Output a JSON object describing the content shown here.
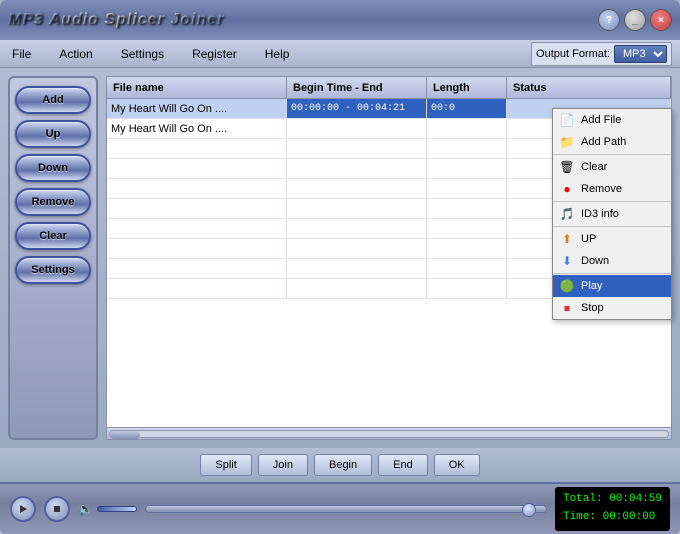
{
  "app": {
    "title": "MP3 Audio Splicer Joiner"
  },
  "title_controls": {
    "info": "?",
    "minimize": "_",
    "close": "×"
  },
  "menu": {
    "items": [
      {
        "id": "file",
        "label": "File"
      },
      {
        "id": "action",
        "label": "Action"
      },
      {
        "id": "settings",
        "label": "Settings"
      },
      {
        "id": "register",
        "label": "Register"
      },
      {
        "id": "help",
        "label": "Help"
      }
    ],
    "output_label": "Output Format:",
    "output_value": "MP3"
  },
  "sidebar": {
    "buttons": [
      {
        "id": "add",
        "label": "Add"
      },
      {
        "id": "up",
        "label": "Up"
      },
      {
        "id": "down",
        "label": "Down"
      },
      {
        "id": "remove",
        "label": "Remove"
      },
      {
        "id": "clear",
        "label": "Clear"
      },
      {
        "id": "settings",
        "label": "Settings"
      }
    ]
  },
  "table": {
    "headers": [
      {
        "id": "filename",
        "label": "File name"
      },
      {
        "id": "begin-end",
        "label": "Begin Time - End"
      },
      {
        "id": "length",
        "label": "Length"
      },
      {
        "id": "status",
        "label": "Status"
      }
    ],
    "rows": [
      {
        "filename": "My Heart Will Go On ....",
        "begin_end": "00:00:00 - 00:04:21",
        "length": "00:0",
        "status": "",
        "selected": true
      },
      {
        "filename": "My Heart Will Go On ....",
        "begin_end": "",
        "length": "",
        "status": "",
        "selected": false
      }
    ]
  },
  "context_menu": {
    "items": [
      {
        "id": "add-file",
        "label": "Add File",
        "icon": "📄"
      },
      {
        "id": "add-path",
        "label": "Add Path",
        "icon": "📁"
      },
      {
        "id": "clear",
        "label": "Clear",
        "icon": "🗑"
      },
      {
        "id": "remove",
        "label": "Remove",
        "icon": "❌"
      },
      {
        "id": "id3-info",
        "label": "ID3 info",
        "icon": "🎵"
      },
      {
        "id": "up",
        "label": "UP",
        "icon": "⬆"
      },
      {
        "id": "down",
        "label": "Down",
        "icon": "⬇"
      },
      {
        "id": "play",
        "label": "Play",
        "icon": "▶",
        "selected": true
      },
      {
        "id": "stop",
        "label": "Stop",
        "icon": "⏹"
      }
    ]
  },
  "bottom_buttons": [
    {
      "id": "split",
      "label": "Split"
    },
    {
      "id": "join",
      "label": "Join"
    },
    {
      "id": "begin",
      "label": "Begin"
    },
    {
      "id": "end",
      "label": "End"
    },
    {
      "id": "ok",
      "label": "OK"
    }
  ],
  "player": {
    "total_label": "Total:",
    "total_time": "00:04:59",
    "time_label": "Time:",
    "current_time": "00:00:00"
  }
}
